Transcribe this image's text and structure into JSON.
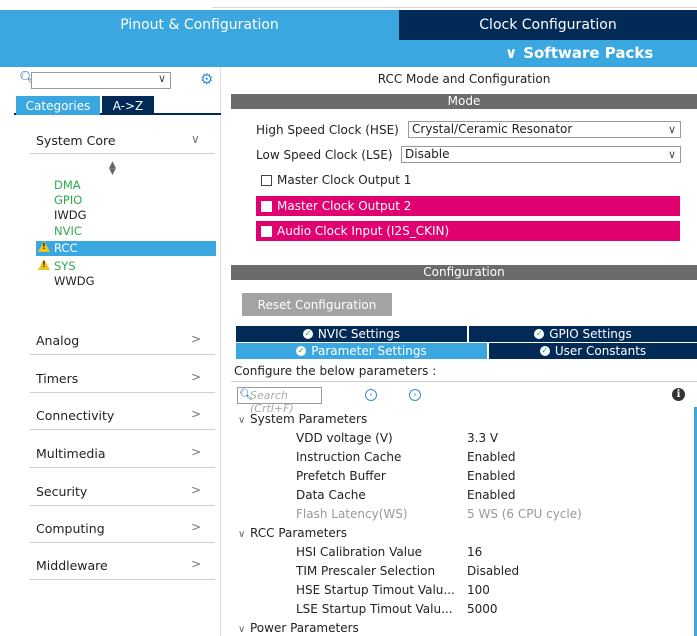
{
  "tabs": {
    "pinout": "Pinout & Configuration",
    "clock": "Clock Configuration",
    "software_packs": "Software Packs"
  },
  "sidebar": {
    "search_value": "",
    "category_tabs": [
      "Categories",
      "A->Z"
    ],
    "system_core": {
      "label": "System Core",
      "items": [
        {
          "name": "DMA",
          "status": "ok"
        },
        {
          "name": "GPIO",
          "status": "ok"
        },
        {
          "name": "IWDG",
          "status": "none"
        },
        {
          "name": "NVIC",
          "status": "ok"
        },
        {
          "name": "RCC",
          "status": "warning",
          "selected": true
        },
        {
          "name": "SYS",
          "status": "warning"
        },
        {
          "name": "WWDG",
          "status": "none"
        }
      ]
    },
    "groups": [
      "Analog",
      "Timers",
      "Connectivity",
      "Multimedia",
      "Security",
      "Computing",
      "Middleware"
    ]
  },
  "main": {
    "title": "RCC Mode and Configuration",
    "mode_bar": "Mode",
    "hse_label": "High Speed Clock (HSE)",
    "hse_value": "Crystal/Ceramic Resonator",
    "lse_label": "Low Speed Clock (LSE)",
    "lse_value": "Disable",
    "mco1_label": "Master Clock Output 1",
    "mco2_label": "Master Clock Output 2",
    "audio_label": "Audio Clock Input (I2S_CKIN)",
    "config_bar": "Configuration",
    "reset_label": "Reset Configuration",
    "config_tabs": {
      "nvic": "NVIC Settings",
      "gpio": "GPIO Settings",
      "params": "Parameter Settings",
      "user": "User Constants"
    },
    "configure_text": "Configure the below parameters :",
    "search_placeholder": "Search (Crtl+F)",
    "system_params_label": "System Parameters",
    "system_params": [
      {
        "name": "VDD voltage (V)",
        "value": "3.3 V",
        "dim": false
      },
      {
        "name": "Instruction Cache",
        "value": "Enabled",
        "dim": false
      },
      {
        "name": "Prefetch Buffer",
        "value": "Enabled",
        "dim": false
      },
      {
        "name": "Data Cache",
        "value": "Enabled",
        "dim": false
      },
      {
        "name": "Flash Latency(WS)",
        "value": "5 WS (6 CPU cycle)",
        "dim": true
      }
    ],
    "rcc_params_label": "RCC Parameters",
    "rcc_params": [
      {
        "name": "HSI Calibration Value",
        "value": "16"
      },
      {
        "name": "TIM Prescaler Selection",
        "value": "Disabled"
      },
      {
        "name": "HSE Startup Timout Valu...",
        "value": "100"
      },
      {
        "name": "LSE Startup Timout Valu...",
        "value": "5000"
      }
    ],
    "power_params_label": "Power Parameters"
  },
  "colors": {
    "accent_blue": "#3ba7e0",
    "navy": "#022a57",
    "pink": "#e1006f",
    "green": "#2fa84f",
    "warning": "#f0c419"
  }
}
